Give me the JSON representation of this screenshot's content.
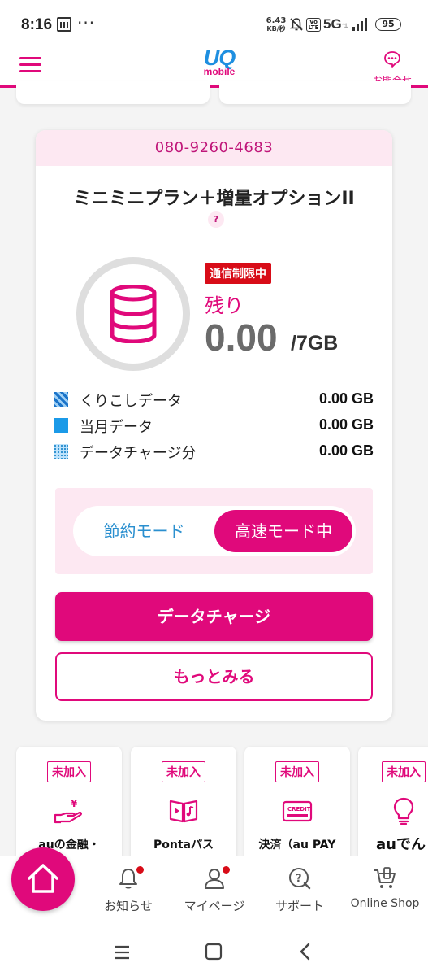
{
  "status_bar": {
    "time": "8:16",
    "more": "···",
    "speed_value": "6.43",
    "speed_unit": "KB/秒",
    "network": "5G",
    "volte": "Vo LTE",
    "battery": "95"
  },
  "header": {
    "logo_top": "UQ",
    "logo_bottom": "mobile",
    "contact_label": "お問合せ"
  },
  "usage_card": {
    "phone_number": "080-9260-4683",
    "plan_name": "ミニミニプラン＋増量オプションII",
    "help_icon": "?",
    "restriction_badge": "通信制限中",
    "remaining_label": "残り",
    "remaining_value": "0.00",
    "remaining_total": "/7GB",
    "legend": [
      {
        "label": "くりこしデータ",
        "value": "0.00 GB",
        "icon": "striped-square-icon"
      },
      {
        "label": "当月データ",
        "value": "0.00 GB",
        "icon": "solid-square-icon"
      },
      {
        "label": "データチャージ分",
        "value": "0.00 GB",
        "icon": "dotted-square-icon"
      }
    ],
    "mode_save_label": "節約モード",
    "mode_fast_label": "高速モード中",
    "charge_button": "データチャージ",
    "more_button": "もっとみる"
  },
  "services": [
    {
      "badge": "未加入",
      "label": "auの金融・",
      "icon": "money-hand-icon"
    },
    {
      "badge": "未加入",
      "label": "Pontaパス",
      "icon": "video-music-icon"
    },
    {
      "badge": "未加入",
      "label": "決済（au PAY",
      "icon": "credit-card-icon",
      "card_text": "CREDIT"
    },
    {
      "badge": "未加入",
      "label": "auでん",
      "icon": "lightbulb-icon"
    }
  ],
  "bottom_nav": {
    "notice": "お知らせ",
    "mypage": "マイページ",
    "support": "サポート",
    "online_shop": "Online Shop"
  },
  "colors": {
    "brand_magenta": "#e0097b",
    "brand_blue": "#1e8fe0",
    "alert_red": "#d80c18",
    "pink_bg": "#fde8f2"
  }
}
